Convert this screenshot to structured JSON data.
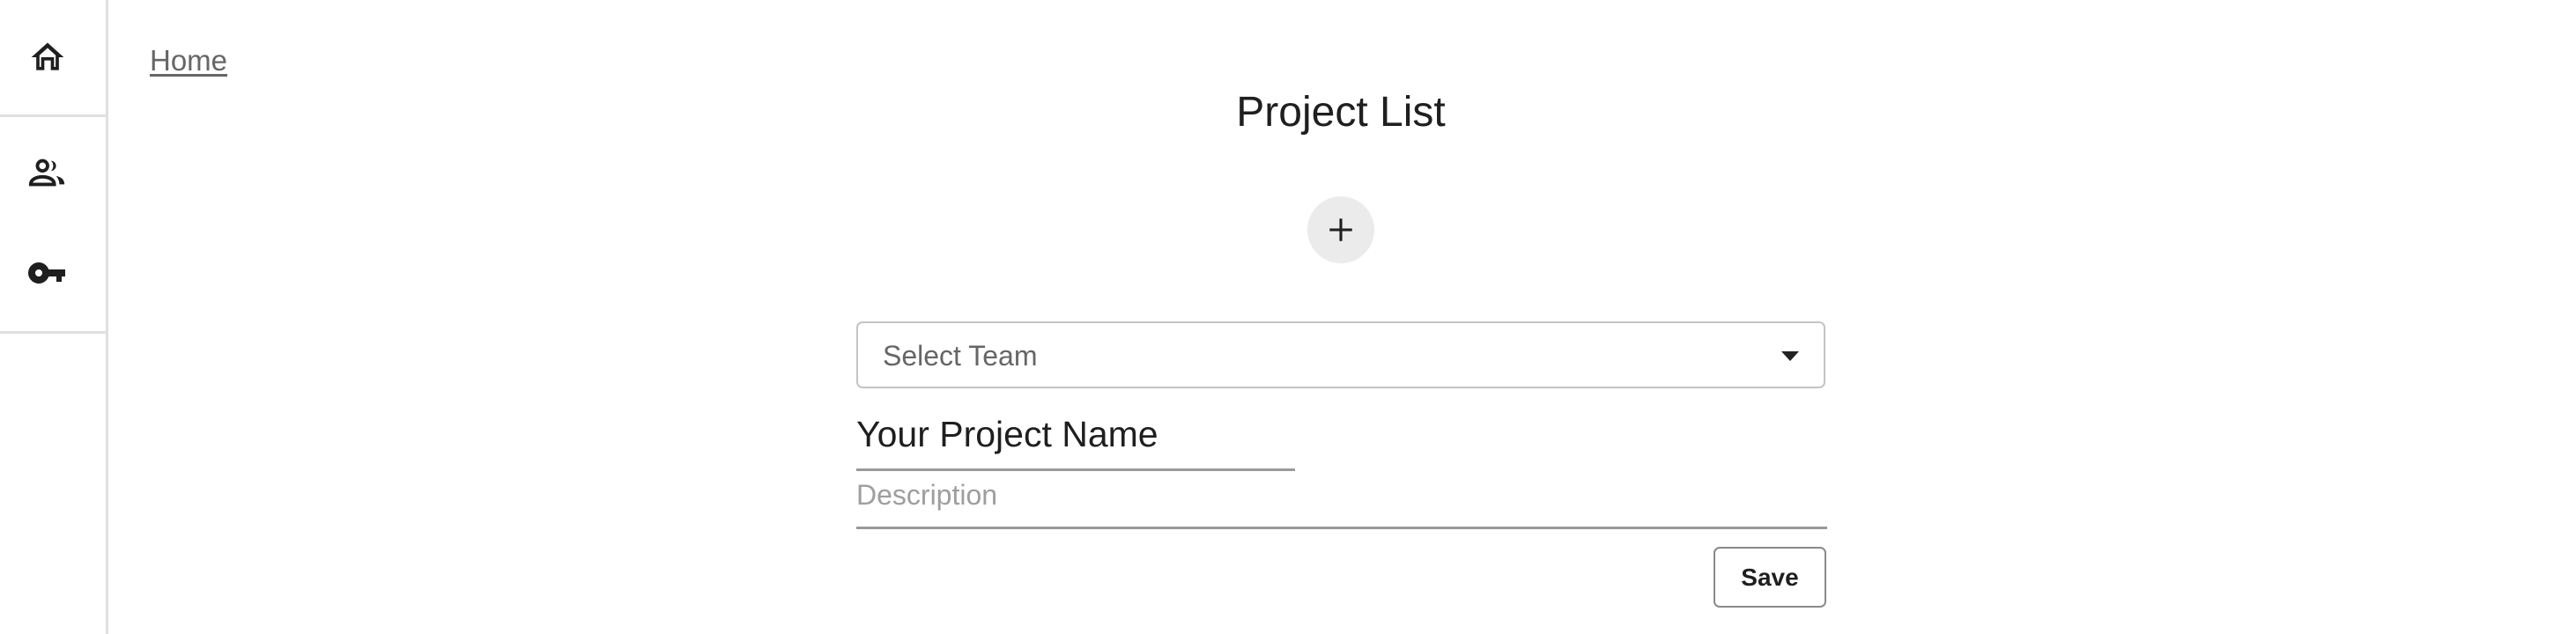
{
  "sidebar": {
    "items": [
      {
        "icon": "home-icon"
      },
      {
        "icon": "people-icon"
      },
      {
        "icon": "key-icon"
      }
    ]
  },
  "breadcrumb": {
    "home_label": "Home"
  },
  "page": {
    "title": "Project List"
  },
  "add_button": {
    "icon": "plus-icon"
  },
  "form": {
    "team_select": {
      "placeholder": "Select Team"
    },
    "project_name": {
      "value": "Your Project Name"
    },
    "description": {
      "placeholder": "Description"
    },
    "save_label": "Save"
  }
}
